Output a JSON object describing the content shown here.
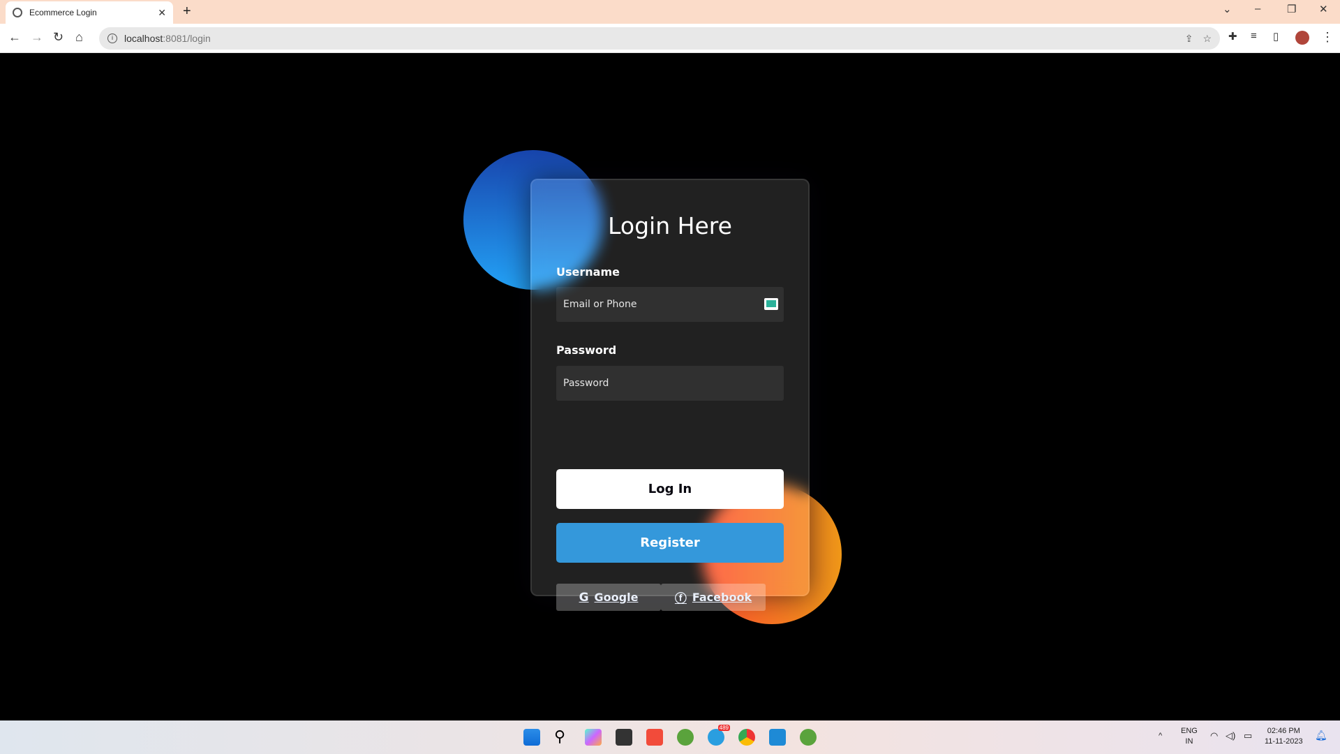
{
  "browser": {
    "tab_title": "Ecommerce Login",
    "url_host": "localhost",
    "url_port_path": ":8081/login"
  },
  "login": {
    "title": "Login Here",
    "username_label": "Username",
    "username_placeholder": "Email or Phone",
    "password_label": "Password",
    "password_placeholder": "Password",
    "login_button": "Log In",
    "register_button": "Register",
    "google_label": "Google",
    "facebook_label": "Facebook"
  },
  "taskbar": {
    "telegram_badge": "489",
    "lang": "ENG",
    "region": "IN",
    "time": "02:46 PM",
    "date": "11-11-2023"
  },
  "colors": {
    "accent": "#3498db",
    "circle_blue": "#1845ad",
    "circle_orange": "#ff512f"
  }
}
